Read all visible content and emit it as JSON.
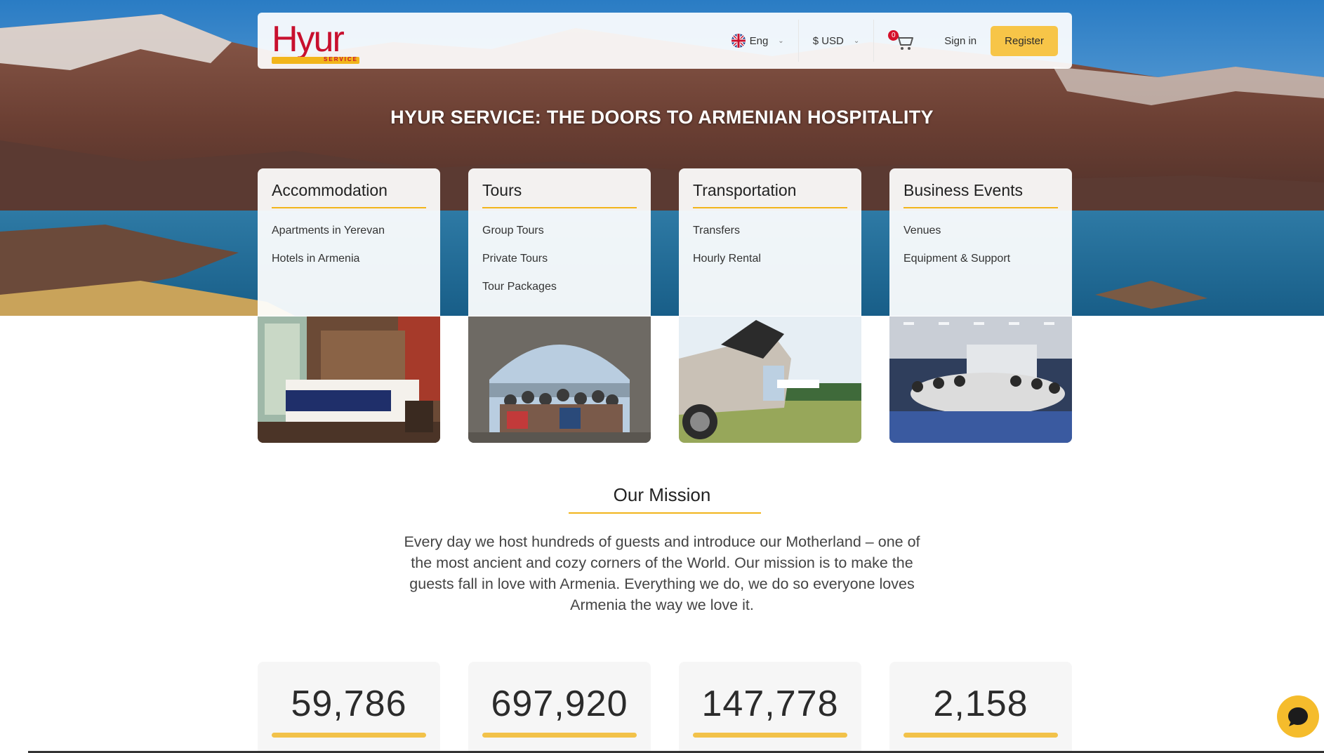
{
  "header": {
    "logo_text": "Hyur",
    "logo_sub": "SERVICE",
    "language": "Eng",
    "currency": "$ USD",
    "cart_count": "0",
    "sign_in": "Sign in",
    "register": "Register"
  },
  "hero": {
    "title": "HYUR SERVICE: THE DOORS TO ARMENIAN HOSPITALITY"
  },
  "categories": [
    {
      "title": "Accommodation",
      "links": [
        "Apartments in Yerevan",
        "Hotels in Armenia"
      ]
    },
    {
      "title": "Tours",
      "links": [
        "Group Tours",
        "Private Tours",
        "Tour Packages"
      ]
    },
    {
      "title": "Transportation",
      "links": [
        "Transfers",
        "Hourly Rental"
      ]
    },
    {
      "title": "Business Events",
      "links": [
        "Venues",
        "Equipment & Support"
      ]
    }
  ],
  "mission": {
    "title": "Our Mission",
    "text": "Every day we host hundreds of guests and introduce our Motherland – one of the most ancient and cozy corners of the World. Our mission is to make the guests fall in love with Armenia. Everything we do, we do so everyone loves Armenia the way we love it."
  },
  "stats": [
    "59,786",
    "697,920",
    "147,778",
    "2,158"
  ],
  "colors": {
    "accent": "#f2b51b",
    "brand_red": "#c8102e",
    "register_bg": "#f7c548"
  }
}
